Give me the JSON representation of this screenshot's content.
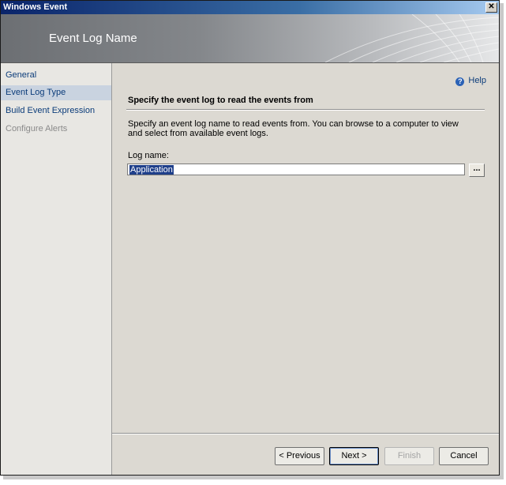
{
  "window": {
    "title": "Windows Event",
    "close_glyph": "✕"
  },
  "banner": {
    "title": "Event Log Name"
  },
  "nav": {
    "items": [
      {
        "label": "General",
        "state": "normal"
      },
      {
        "label": "Event Log Type",
        "state": "selected"
      },
      {
        "label": "Build Event Expression",
        "state": "normal"
      },
      {
        "label": "Configure Alerts",
        "state": "disabled"
      }
    ]
  },
  "content": {
    "help_label": "Help",
    "heading": "Specify the event log to read the events from",
    "description": "Specify an event log name to read events from. You can browse to a computer to view and select from available event logs.",
    "log_name_label": "Log name:",
    "log_name_value": "Application",
    "browse_label": "..."
  },
  "buttons": {
    "previous": "< Previous",
    "next": "Next >",
    "finish": "Finish",
    "cancel": "Cancel"
  },
  "icons": {
    "help": "help-icon",
    "close": "close-icon"
  },
  "colors": {
    "nav_link": "#0b3c7a",
    "selected_nav": "#c9d3e0",
    "selection": "#1f3f8a"
  }
}
